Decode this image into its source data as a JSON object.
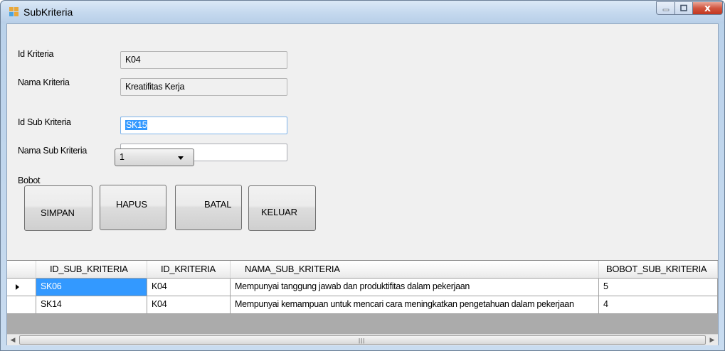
{
  "window": {
    "title": "SubKriteria",
    "controls": {
      "minimize": "minimize",
      "maximize": "maximize",
      "close": "x"
    }
  },
  "form": {
    "id_kriteria_label": "Id Kriteria",
    "id_kriteria_value": "K04",
    "nama_kriteria_label": "Nama Kriteria",
    "nama_kriteria_value": "Kreatifitas Kerja",
    "id_sub_label": "Id Sub Kriteria",
    "id_sub_value": "SK15",
    "nama_sub_label": "Nama Sub Kriteria",
    "nama_sub_value": "",
    "bobot_label": "Bobot",
    "bobot_value": "1"
  },
  "buttons": {
    "simpan": "SIMPAN",
    "hapus": "HAPUS",
    "batal": "BATAL",
    "keluar": "KELUAR"
  },
  "grid": {
    "columns": [
      "ID_SUB_KRITERIA",
      "ID_KRITERIA",
      "NAMA_SUB_KRITERIA",
      "BOBOT_SUB_KRITERIA"
    ],
    "rows": [
      [
        "SK06",
        "K04",
        "Mempunyai tanggung jawab dan produktifitas dalam pekerjaan",
        "5"
      ],
      [
        "SK14",
        "K04",
        "Mempunyai kemampuan untuk mencari cara meningkatkan pengetahuan dalam pekerjaan",
        "4"
      ]
    ],
    "selected_row": 0
  },
  "colors": {
    "selection": "#3399ff",
    "close_button": "#c2361f",
    "titlebar": "#c4d8ee"
  }
}
